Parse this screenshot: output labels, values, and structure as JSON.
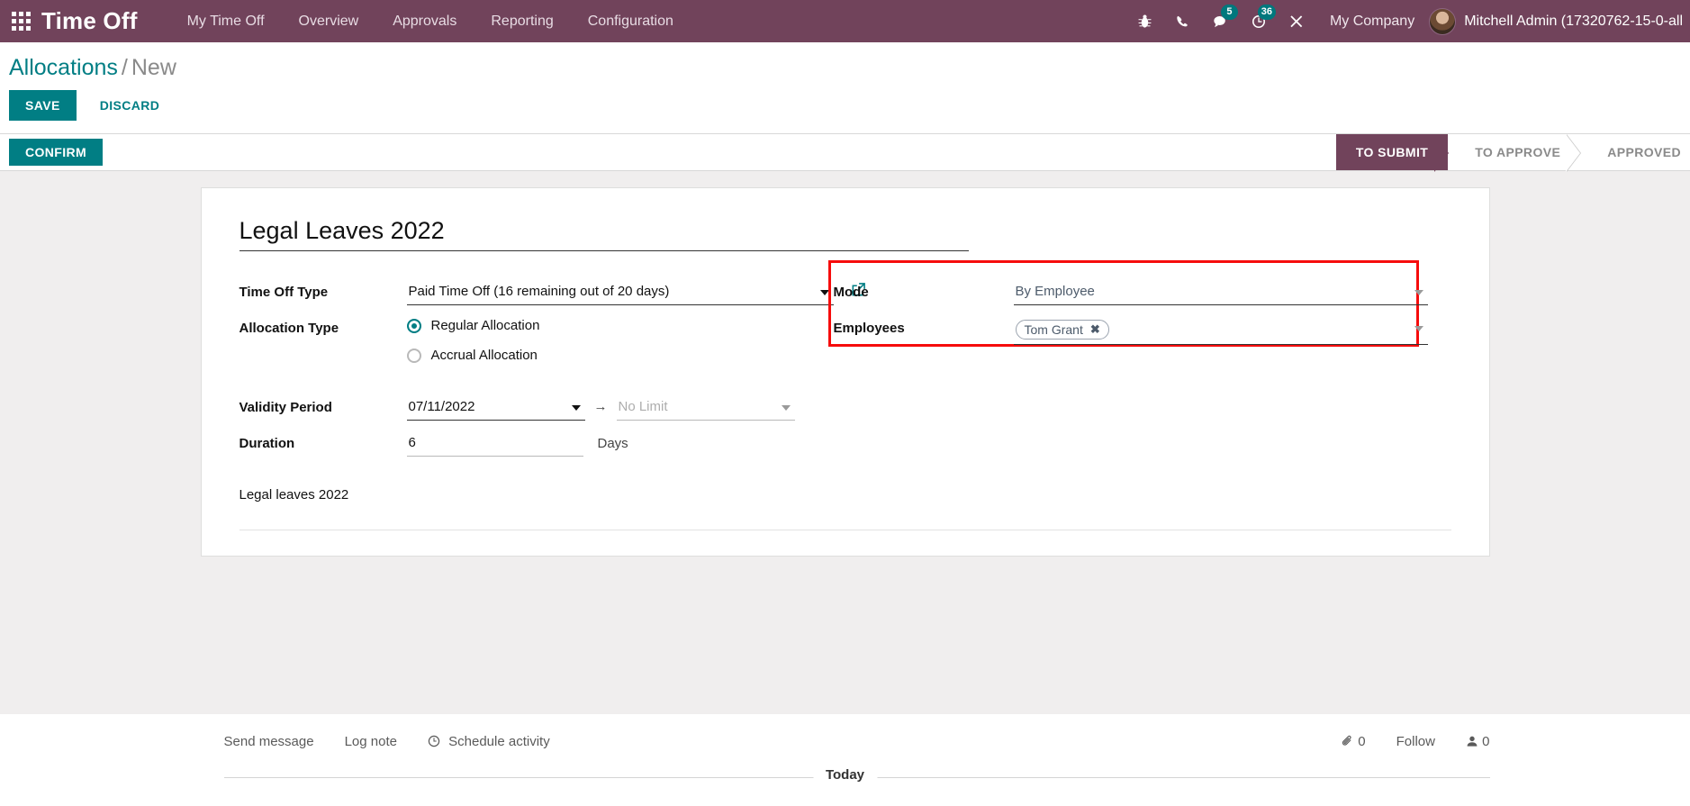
{
  "navbar": {
    "apps_icon": "apps-grid-icon",
    "brand": "Time Off",
    "menus": [
      {
        "label": "My Time Off"
      },
      {
        "label": "Overview"
      },
      {
        "label": "Approvals"
      },
      {
        "label": "Reporting"
      },
      {
        "label": "Configuration"
      }
    ],
    "sys_icons": [
      {
        "name": "bug-icon",
        "glyph": "🐞",
        "badge": ""
      },
      {
        "name": "phone-icon",
        "glyph": "✆",
        "badge": ""
      },
      {
        "name": "messages-icon",
        "glyph": "💬",
        "badge": "5"
      },
      {
        "name": "activities-clock-icon",
        "glyph": "◔",
        "badge": "36"
      },
      {
        "name": "tools-icon",
        "glyph": "⚒",
        "badge": ""
      }
    ],
    "company": "My Company",
    "user": "Mitchell Admin (17320762-15-0-all",
    "avatar_name": "user-avatar"
  },
  "breadcrumb": {
    "root": "Allocations",
    "separator": "/",
    "current": "New"
  },
  "control_panel": {
    "save_label": "SAVE",
    "discard_label": "DISCARD"
  },
  "statusbar": {
    "confirm_label": "CONFIRM",
    "stages": [
      {
        "label": "TO SUBMIT",
        "active": true
      },
      {
        "label": "TO APPROVE",
        "active": false
      },
      {
        "label": "APPROVED",
        "active": false
      }
    ]
  },
  "form": {
    "title": "Legal Leaves 2022",
    "time_off_type": {
      "label": "Time Off Type",
      "value": "Paid Time Off (16 remaining out of 20 days)",
      "external_link_icon": "external-link-icon"
    },
    "allocation_type": {
      "label": "Allocation Type",
      "options": [
        {
          "label": "Regular Allocation",
          "selected": true
        },
        {
          "label": "Accrual Allocation",
          "selected": false
        }
      ]
    },
    "validity_period": {
      "label": "Validity Period",
      "from_value": "07/11/2022",
      "arrow": "→",
      "to_placeholder": "No Limit"
    },
    "duration": {
      "label": "Duration",
      "value": "6",
      "unit": "Days"
    },
    "description": "Legal leaves 2022",
    "mode": {
      "label": "Mode",
      "value": "By Employee"
    },
    "employees": {
      "label": "Employees",
      "tags": [
        {
          "name": "Tom Grant",
          "remove_icon": "✖"
        }
      ]
    },
    "highlight_color": "#f60c0c"
  },
  "chatter": {
    "send_message": "Send message",
    "log_note": "Log note",
    "schedule_activity": "Schedule activity",
    "schedule_icon": "⏱",
    "attachment_icon": "📎",
    "attachment_count": "0",
    "follow_label": "Follow",
    "followers_icon": "👤",
    "followers_count": "0",
    "today_divider": "Today"
  },
  "colors": {
    "brand_purple": "#71435b",
    "accent_teal": "#017e84",
    "highlight_red": "#f60c0c",
    "badge_teal": "#00787d"
  }
}
